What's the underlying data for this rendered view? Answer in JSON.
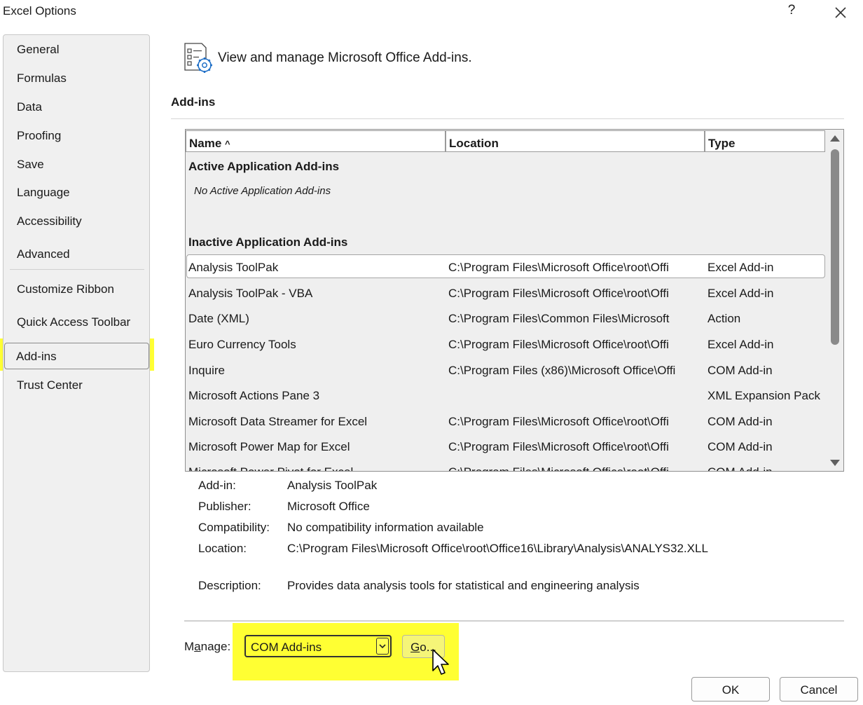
{
  "window": {
    "title": "Excel Options",
    "help_label": "?"
  },
  "sidebar": {
    "items": [
      {
        "label": "General"
      },
      {
        "label": "Formulas"
      },
      {
        "label": "Data"
      },
      {
        "label": "Proofing"
      },
      {
        "label": "Save"
      },
      {
        "label": "Language"
      },
      {
        "label": "Accessibility"
      },
      {
        "label": "Advanced"
      },
      {
        "label": "Customize Ribbon"
      },
      {
        "label": "Quick Access Toolbar"
      },
      {
        "label": "Add-ins"
      },
      {
        "label": "Trust Center"
      }
    ],
    "selected": "Add-ins",
    "highlight_color": "#ffff33"
  },
  "header": {
    "text": "View and manage Microsoft Office Add-ins.",
    "icon": "addins-settings-icon"
  },
  "addins": {
    "section_title": "Add-ins",
    "columns": {
      "name": "Name",
      "sort_indicator": "^",
      "location": "Location",
      "type": "Type"
    },
    "active_group": "Active Application Add-ins",
    "active_empty": "No Active Application Add-ins",
    "inactive_group": "Inactive Application Add-ins",
    "rows": [
      {
        "name": "Analysis ToolPak",
        "location": "C:\\Program Files\\Microsoft Office\\root\\Offi",
        "type": "Excel Add-in"
      },
      {
        "name": "Analysis ToolPak - VBA",
        "location": "C:\\Program Files\\Microsoft Office\\root\\Offi",
        "type": "Excel Add-in"
      },
      {
        "name": "Date (XML)",
        "location": "C:\\Program Files\\Common Files\\Microsoft",
        "type": "Action"
      },
      {
        "name": "Euro Currency Tools",
        "location": "C:\\Program Files\\Microsoft Office\\root\\Offi",
        "type": "Excel Add-in"
      },
      {
        "name": "Inquire",
        "location": "C:\\Program Files (x86)\\Microsoft Office\\Offi",
        "type": "COM Add-in"
      },
      {
        "name": "Microsoft Actions Pane 3",
        "location": "",
        "type": "XML Expansion Pack"
      },
      {
        "name": "Microsoft Data Streamer for Excel",
        "location": "C:\\Program Files\\Microsoft Office\\root\\Offi",
        "type": "COM Add-in"
      },
      {
        "name": "Microsoft Power Map for Excel",
        "location": "C:\\Program Files\\Microsoft Office\\root\\Offi",
        "type": "COM Add-in"
      },
      {
        "name": "Microsoft Power Pivot for Excel",
        "location": "C:\\Program Files\\Microsoft Office\\root\\Offi",
        "type": "COM Add-in"
      }
    ],
    "selected_row": "Analysis ToolPak"
  },
  "details": {
    "addin_label": "Add-in:",
    "addin_value": "Analysis ToolPak",
    "publisher_label": "Publisher:",
    "publisher_value": "Microsoft Office",
    "compat_label": "Compatibility:",
    "compat_value": "No compatibility information available",
    "location_label": "Location:",
    "location_value": "C:\\Program Files\\Microsoft Office\\root\\Office16\\Library\\Analysis\\ANALYS32.XLL",
    "description_label": "Description:",
    "description_value": "Provides data analysis tools for statistical and engineering analysis"
  },
  "manage": {
    "label_pre": "M",
    "label_accel": "a",
    "label_post": "nage:",
    "selected_value": "COM Add-ins",
    "go_accel": "G",
    "go_post": "o..."
  },
  "buttons": {
    "ok": "OK",
    "cancel": "Cancel"
  }
}
